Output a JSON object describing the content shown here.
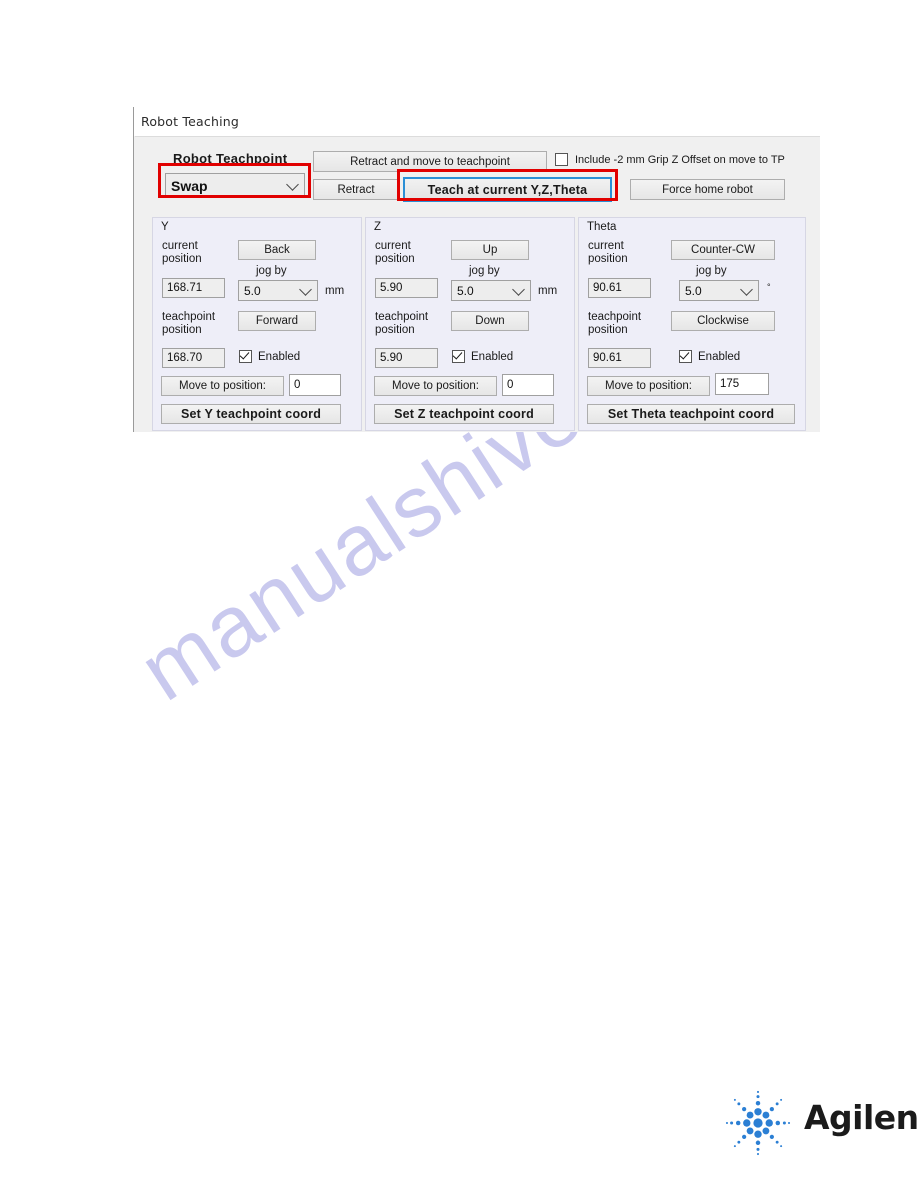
{
  "page": {
    "watermark": "manualshive.com",
    "brand": "Agilent"
  },
  "dialog": {
    "title": "Robot Teaching",
    "teachpoint": {
      "label": "Robot Teachpoint",
      "selected": "Swap"
    },
    "actions": {
      "retract_and_move": "Retract and move to teachpoint",
      "retract": "Retract",
      "teach_at_current": "Teach at current Y,Z,Theta",
      "force_home": "Force home robot"
    },
    "grip_offset": {
      "label": "Include -2 mm Grip Z Offset on move to TP",
      "checked": false
    },
    "axes": [
      {
        "key": "Y",
        "group_label": "Y",
        "current_position_label": "current position",
        "current_position_value": "168.71",
        "teachpoint_position_label": "teachpoint position",
        "teachpoint_position_value": "168.70",
        "jog_positive_label": "Back",
        "jog_negative_label": "Forward",
        "jog_by_label": "jog by",
        "jog_by_value": "5.0",
        "unit": "mm",
        "enabled_label": "Enabled",
        "enabled": true,
        "move_to_label": "Move to position:",
        "move_to_value": "0",
        "set_coord_label": "Set Y teachpoint coord"
      },
      {
        "key": "Z",
        "group_label": "Z",
        "current_position_label": "current position",
        "current_position_value": "5.90",
        "teachpoint_position_label": "teachpoint position",
        "teachpoint_position_value": "5.90",
        "jog_positive_label": "Up",
        "jog_negative_label": "Down",
        "jog_by_label": "jog by",
        "jog_by_value": "5.0",
        "unit": "mm",
        "enabled_label": "Enabled",
        "enabled": true,
        "move_to_label": "Move to position:",
        "move_to_value": "0",
        "set_coord_label": "Set Z teachpoint coord"
      },
      {
        "key": "Theta",
        "group_label": "Theta",
        "current_position_label": "current position",
        "current_position_value": "90.61",
        "teachpoint_position_label": "teachpoint position",
        "teachpoint_position_value": "90.61",
        "jog_positive_label": "Counter-CW",
        "jog_negative_label": "Clockwise",
        "jog_by_label": "jog by",
        "jog_by_value": "5.0",
        "unit": "°",
        "enabled_label": "Enabled",
        "enabled": true,
        "move_to_label": "Move to position:",
        "move_to_value": "175",
        "set_coord_label": "Set Theta teachpoint coord"
      }
    ]
  },
  "annotations": {
    "highlight_color": "#e10000",
    "focus_color": "#2b8fd6"
  }
}
